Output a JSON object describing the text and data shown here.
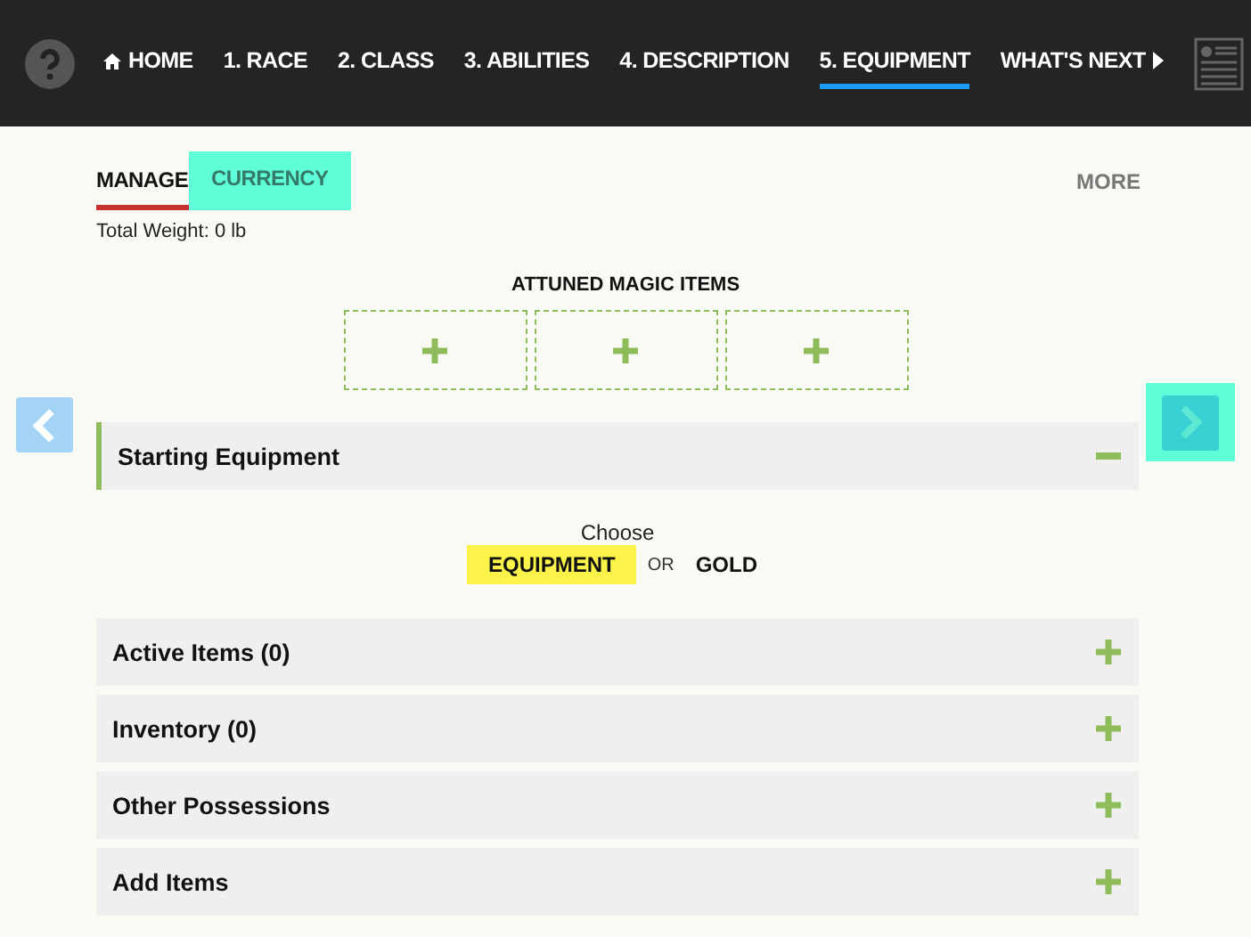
{
  "nav": {
    "items": [
      {
        "label": "HOME",
        "kind": "home",
        "selected": false
      },
      {
        "label": "1. RACE",
        "kind": "step",
        "selected": false
      },
      {
        "label": "2. CLASS",
        "kind": "step",
        "selected": false
      },
      {
        "label": "3. ABILITIES",
        "kind": "step",
        "selected": false
      },
      {
        "label": "4. DESCRIPTION",
        "kind": "step",
        "selected": false
      },
      {
        "label": "5. EQUIPMENT",
        "kind": "step",
        "selected": true
      },
      {
        "label": "WHAT'S NEXT",
        "kind": "next",
        "selected": false
      }
    ]
  },
  "tabs": [
    {
      "label": "MANAGE",
      "selected": true,
      "highlighted": false
    },
    {
      "label": "CURRENCY",
      "selected": false,
      "highlighted": true
    }
  ],
  "more": "MORE",
  "total_weight": "Total Weight: 0 lb",
  "attuned": {
    "title": "ATTUNED MAGIC ITEMS",
    "slots": [
      {
        "kind": "empty"
      },
      {
        "kind": "empty"
      },
      {
        "kind": "empty"
      }
    ]
  },
  "pager": {
    "prev_highlighted": false,
    "next_highlighted": true
  },
  "sections": [
    {
      "title": "Starting Equipment",
      "expanded": true,
      "choose": {
        "label": "Choose",
        "separator": "OR",
        "options": [
          {
            "label": "EQUIPMENT",
            "highlighted": true
          },
          {
            "label": "GOLD",
            "highlighted": false
          }
        ]
      }
    },
    {
      "title": "Active Items (0)",
      "expanded": false
    },
    {
      "title": "Inventory (0)",
      "expanded": false
    },
    {
      "title": "Other Possessions",
      "expanded": false
    },
    {
      "title": "Add Items",
      "expanded": false
    }
  ]
}
